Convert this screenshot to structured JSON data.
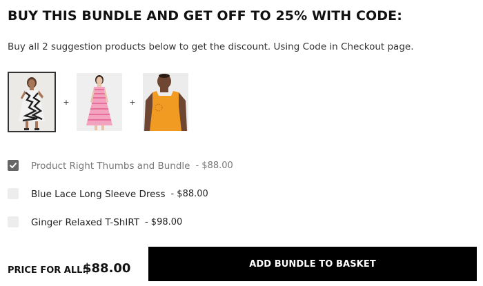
{
  "bundle": {
    "title": "BUY THIS BUNDLE AND GET OFF TO 25% WITH CODE:",
    "subtitle": "Buy all 2 suggestion products below to get the discount. Using Code in Checkout page.",
    "thumbnails": [
      {
        "image": "model-in-patterned-black-white-dress",
        "selected": true
      },
      {
        "image": "model-in-pink-striped-dress",
        "selected": false
      },
      {
        "image": "model-in-orange-tank-top",
        "selected": false
      }
    ],
    "separator": "+",
    "items": [
      {
        "name": "Product Right Thumbs and Bundle",
        "price": "- $88.00",
        "checked": true
      },
      {
        "name": "Blue Lace Long Sleeve Dress",
        "price": "- $88.00",
        "checked": false
      },
      {
        "name": "Ginger Relaxed T-ShIRT",
        "price": "- $98.00",
        "checked": false
      }
    ],
    "price_label": "PRICE FOR ALL:",
    "price_value": "$88.00",
    "add_button_label": "ADD BUNDLE TO BASKET"
  },
  "colors": {
    "button_background": "#000000",
    "button_text": "#ffffff",
    "checkbox_checked": "#666666",
    "checkbox_unchecked": "#ededed"
  }
}
